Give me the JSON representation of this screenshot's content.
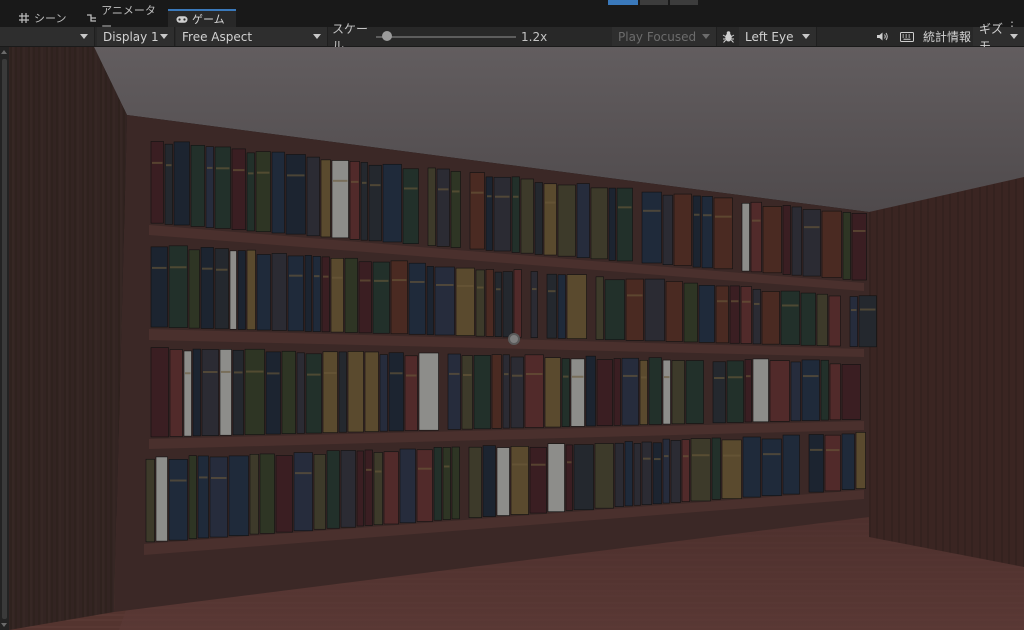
{
  "tabs": [
    {
      "label": "シーン",
      "icon": "grid-icon"
    },
    {
      "label": "アニメーター",
      "icon": "animator-icon"
    },
    {
      "label": "ゲーム",
      "icon": "gamepad-icon",
      "active": true
    }
  ],
  "toolbar": {
    "display": "Display 1",
    "aspect": "Free Aspect",
    "scale_label": "スケール",
    "scale_value": "1.2x",
    "scale_level": 0.08,
    "play_mode": "Play Focused",
    "eye": "Left Eye",
    "stats_label": "統計情報",
    "gizmos_label": "ギズモ",
    "icons": [
      "bug-icon",
      "speaker-icon",
      "keyboard-icon"
    ]
  },
  "colors": {
    "accent": "#3a79bb",
    "toolbar_bg": "#282828",
    "tab_bg": "#191919"
  }
}
